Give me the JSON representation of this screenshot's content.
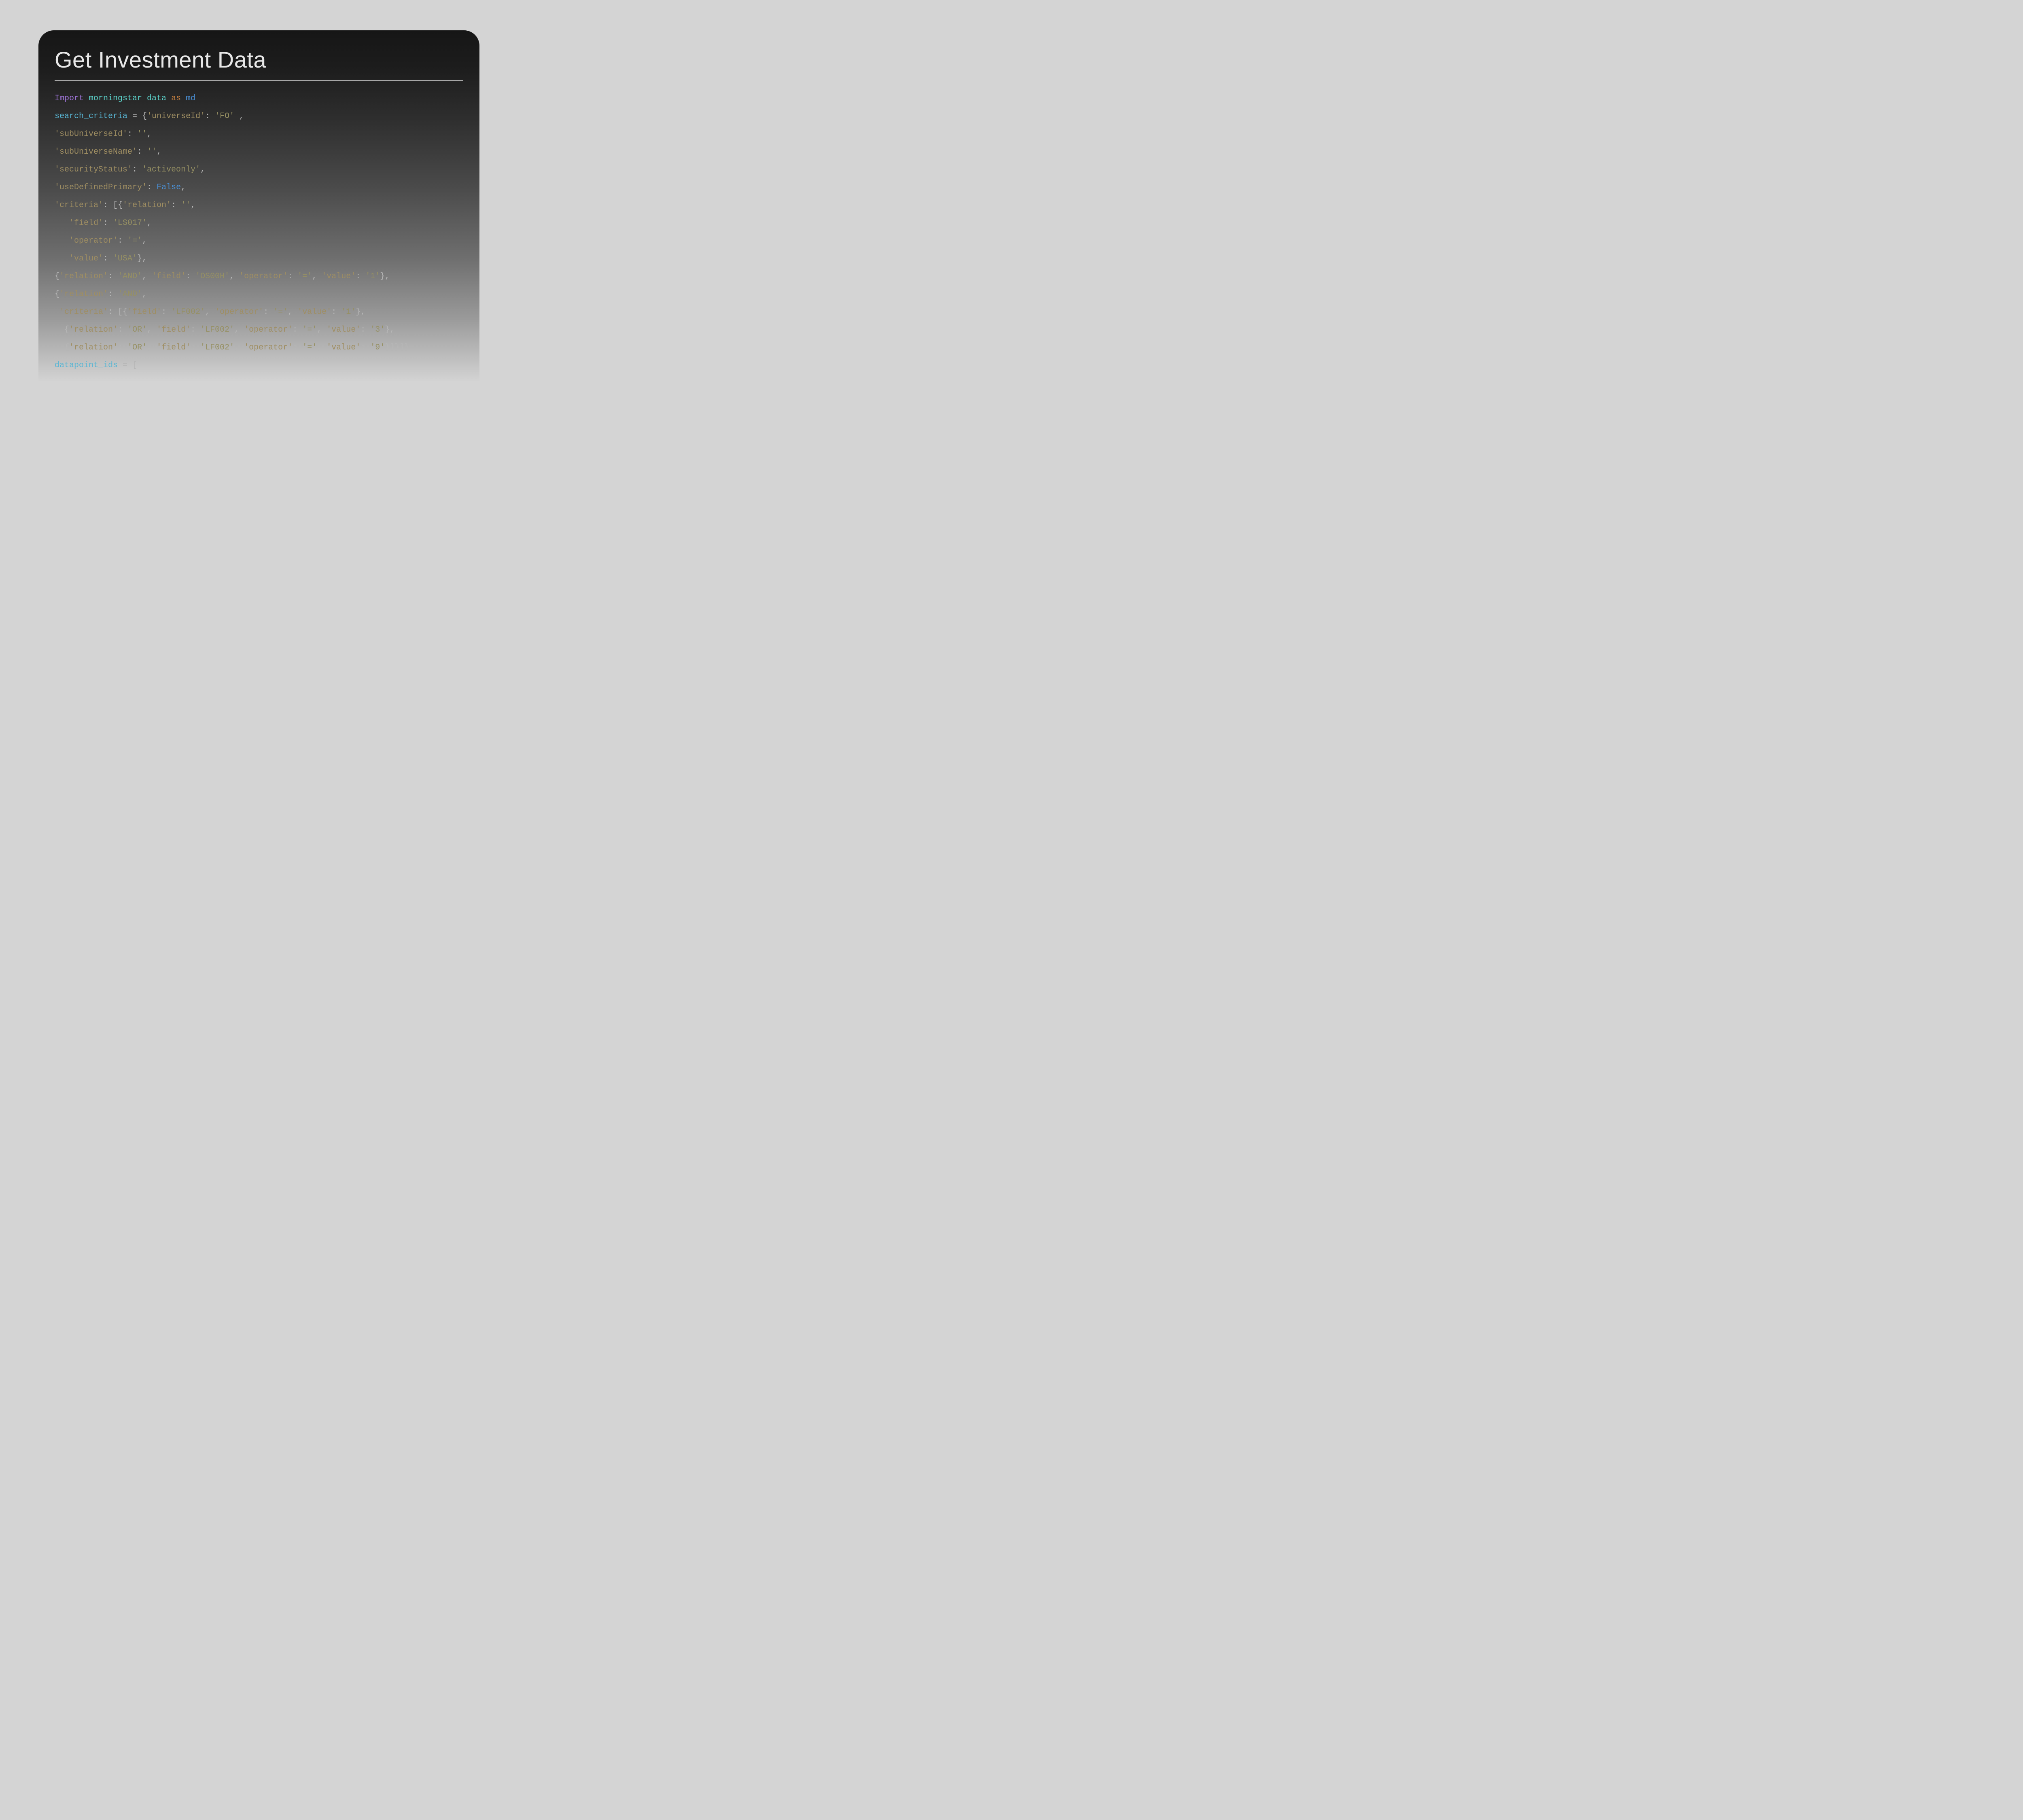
{
  "title": "Get Investment Data",
  "tokens": {
    "import_kw": "Import",
    "module": "morningstar_data",
    "as_kw": "as",
    "alias": "md",
    "var_search": "search_criteria",
    "eq": " = ",
    "false_kw": "False",
    "var_datapoint": "datapoint_ids",
    "brace_open": "{",
    "brace_close": "}",
    "bracket_open": "[",
    "bracket_close": "]",
    "comma": ",",
    "comma_sp": ", ",
    "colon_sp": ": ",
    "sp": " ",
    "ind1": "   ",
    "ind0_1": " ",
    "ind0_2": "  ",
    "k_universeId": "'universeId'",
    "k_subUniverseId": "'subUniverseId'",
    "k_subUniverseName": "'subUniverseName'",
    "k_securityStatus": "'securityStatus'",
    "k_useDefinedPrimary": "'useDefinedPrimary'",
    "k_criteria": "'criteria'",
    "k_relation": "'relation'",
    "k_field": "'field'",
    "k_operator": "'operator'",
    "k_value": "'value'",
    "v_FO": "'FO'",
    "v_empty": "''",
    "v_activeonly": "'activeonly'",
    "v_LS017": "'LS017'",
    "v_eq": "'='",
    "v_USA": "'USA'",
    "v_AND": "'AND'",
    "v_OS00H": "'OS00H'",
    "v_1": "'1'",
    "v_LF002": "'LF002'",
    "v_OR": "'OR'",
    "v_3": "'3'",
    "v_9": "'9'"
  }
}
